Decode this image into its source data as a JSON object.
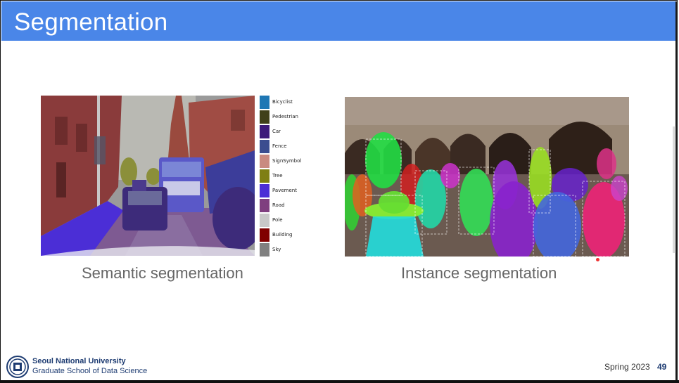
{
  "slide": {
    "title": "Segmentation",
    "captions": {
      "semantic": "Semantic segmentation",
      "instance": "Instance segmentation"
    },
    "legend": [
      {
        "label": "Bicyclist",
        "color": "#1f77b4"
      },
      {
        "label": "Pedestrian",
        "color": "#40401a"
      },
      {
        "label": "Car",
        "color": "#3d1a7a"
      },
      {
        "label": "Fence",
        "color": "#3b4d8f"
      },
      {
        "label": "SignSymbol",
        "color": "#c98a80"
      },
      {
        "label": "Tree",
        "color": "#7f7f14"
      },
      {
        "label": "Pavement",
        "color": "#4b2ed6"
      },
      {
        "label": "Road",
        "color": "#7f3f7f"
      },
      {
        "label": "Pole",
        "color": "#c8c8c8"
      },
      {
        "label": "Building",
        "color": "#800000"
      },
      {
        "label": "Sky",
        "color": "#808080"
      }
    ]
  },
  "footer": {
    "university": "Seoul National University",
    "school": "Graduate School of Data Science",
    "term": "Spring 2023",
    "page": "49"
  },
  "colors": {
    "header_bg": "#4a86e8",
    "brand": "#1e3c72"
  },
  "icons": {
    "logo": "snu-logo-icon"
  }
}
